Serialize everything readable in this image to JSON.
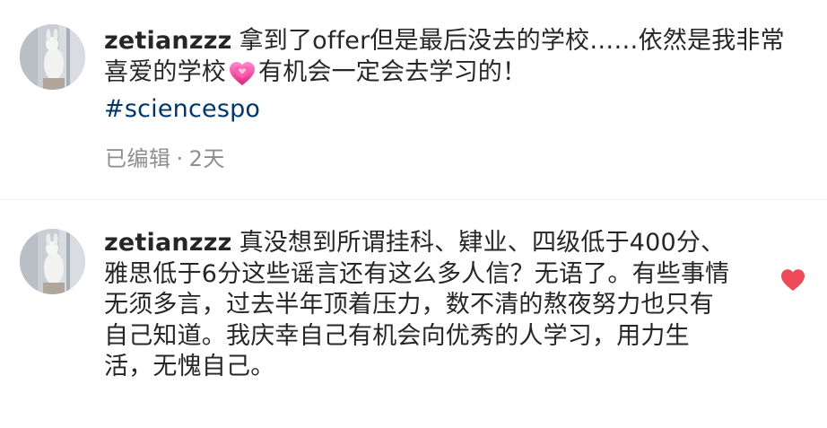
{
  "comments": [
    {
      "username": "zetianzzz",
      "text_before_emoji": "拿到了offer但是最后没去的学校……依然是我非常喜爱的学校",
      "text_after_emoji": "有机会一定会去学习的！",
      "hashtag": "#sciencespo",
      "edited_label": "已编辑",
      "time": "2天",
      "emoji_icon": "growing-heart-emoji"
    },
    {
      "username": "zetianzzz",
      "text": "真没想到所谓挂科、肄业、四级低于400分、雅思低于6分这些谣言还有这么多人信？无语了。有些事情无须多言，过去半年顶着压力，数不清的熬夜努力也只有自己知道。我庆幸自己有机会向优秀的人学习，用力生活，无愧自己。",
      "liked": true,
      "like_icon": "heart-icon",
      "like_color": "#ed4956"
    }
  ],
  "colors": {
    "text": "#262626",
    "secondary": "#8e8e8e",
    "hashtag": "#00376b",
    "divider": "#efefef"
  }
}
